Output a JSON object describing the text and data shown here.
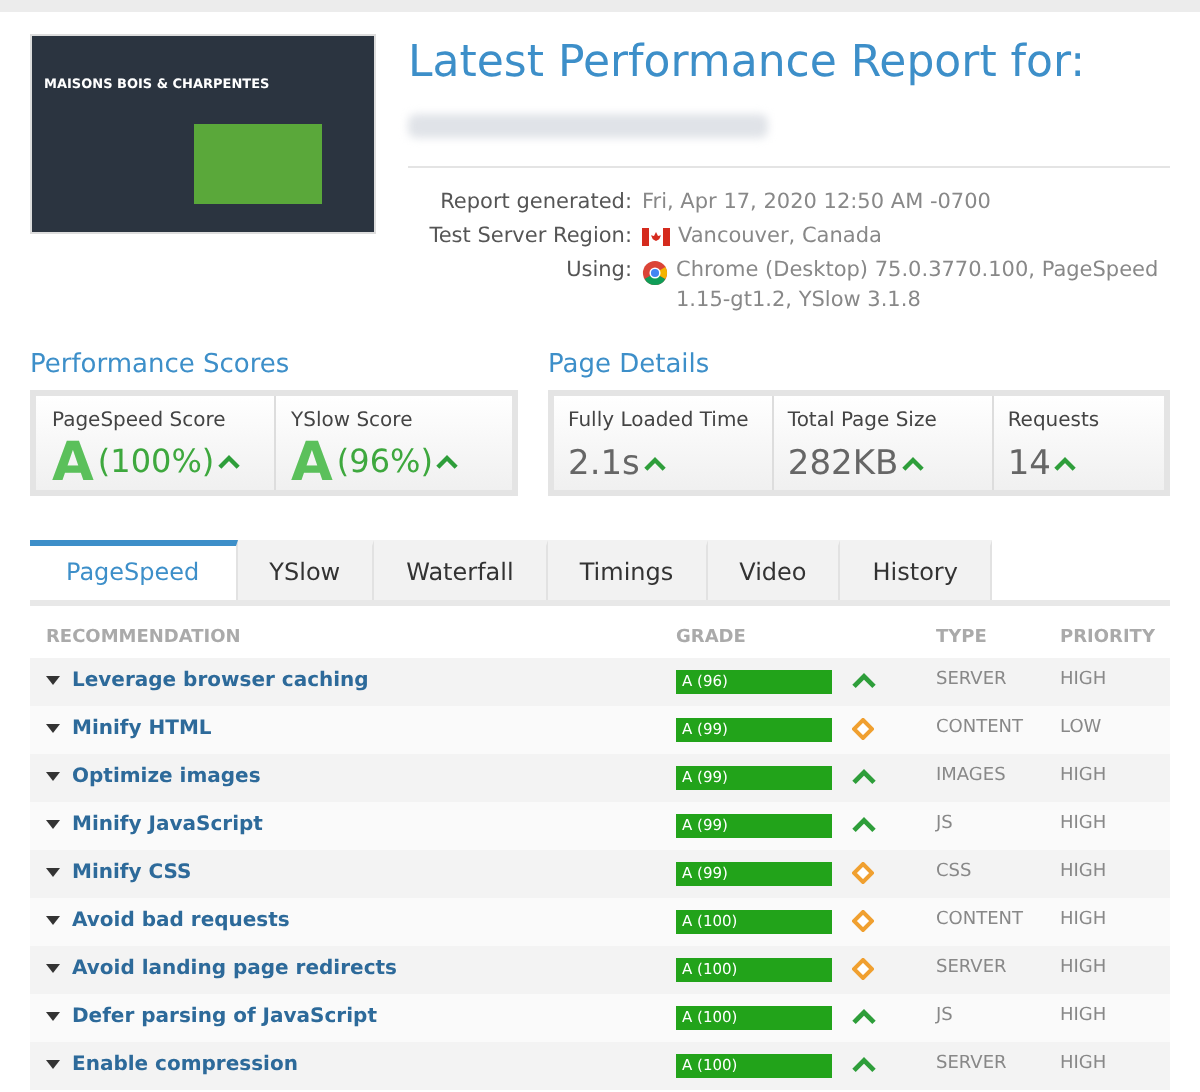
{
  "thumbnail": {
    "headline": "MAISONS BOIS & CHARPENTES"
  },
  "report": {
    "title": "Latest Performance Report for:",
    "info": [
      {
        "label": "Report generated:",
        "value": "Fri, Apr 17, 2020 12:50 AM -0700",
        "kind": "plain"
      },
      {
        "label": "Test Server Region:",
        "value": "Vancouver, Canada",
        "kind": "flag"
      },
      {
        "label": "Using:",
        "value": "Chrome (Desktop) 75.0.3770.100, PageSpeed 1.15-gt1.2, YSlow 3.1.8",
        "kind": "browser"
      }
    ]
  },
  "performance_scores": {
    "title": "Performance Scores",
    "items": [
      {
        "label": "PageSpeed Score",
        "grade": "A",
        "value": "(100%)"
      },
      {
        "label": "YSlow Score",
        "grade": "A",
        "value": "(96%)"
      }
    ]
  },
  "page_details": {
    "title": "Page Details",
    "items": [
      {
        "label": "Fully Loaded Time",
        "value": "2.1s"
      },
      {
        "label": "Total Page Size",
        "value": "282KB"
      },
      {
        "label": "Requests",
        "value": "14"
      }
    ]
  },
  "tabs": [
    {
      "label": "PageSpeed",
      "selected": true
    },
    {
      "label": "YSlow",
      "selected": false
    },
    {
      "label": "Waterfall",
      "selected": false
    },
    {
      "label": "Timings",
      "selected": false
    },
    {
      "label": "Video",
      "selected": false
    },
    {
      "label": "History",
      "selected": false
    }
  ],
  "table": {
    "columns": [
      "RECOMMENDATION",
      "GRADE",
      "TYPE",
      "PRIORITY"
    ],
    "rows": [
      {
        "name": "Leverage browser caching",
        "grade": "A (96)",
        "kind": "up",
        "type": "SERVER",
        "priority": "HIGH"
      },
      {
        "name": "Minify HTML",
        "grade": "A (99)",
        "kind": "flat",
        "type": "CONTENT",
        "priority": "LOW"
      },
      {
        "name": "Optimize images",
        "grade": "A (99)",
        "kind": "up",
        "type": "IMAGES",
        "priority": "HIGH"
      },
      {
        "name": "Minify JavaScript",
        "grade": "A (99)",
        "kind": "up",
        "type": "JS",
        "priority": "HIGH"
      },
      {
        "name": "Minify CSS",
        "grade": "A (99)",
        "kind": "flat",
        "type": "CSS",
        "priority": "HIGH"
      },
      {
        "name": "Avoid bad requests",
        "grade": "A (100)",
        "kind": "flat",
        "type": "CONTENT",
        "priority": "HIGH"
      },
      {
        "name": "Avoid landing page redirects",
        "grade": "A (100)",
        "kind": "flat",
        "type": "SERVER",
        "priority": "HIGH"
      },
      {
        "name": "Defer parsing of JavaScript",
        "grade": "A (100)",
        "kind": "up",
        "type": "JS",
        "priority": "HIGH"
      },
      {
        "name": "Enable compression",
        "grade": "A (100)",
        "kind": "up",
        "type": "SERVER",
        "priority": "HIGH"
      }
    ]
  }
}
